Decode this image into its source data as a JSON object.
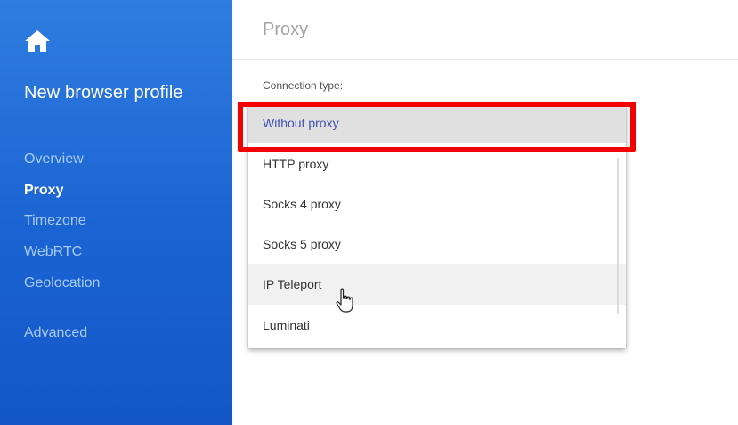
{
  "sidebar": {
    "home_icon": "home-icon",
    "title": "New browser profile",
    "items": [
      {
        "label": "Overview",
        "active": false
      },
      {
        "label": "Proxy",
        "active": true
      },
      {
        "label": "Timezone",
        "active": false
      },
      {
        "label": "WebRTC",
        "active": false
      },
      {
        "label": "Geolocation",
        "active": false
      },
      {
        "label": "Advanced",
        "active": false
      }
    ]
  },
  "main": {
    "title": "Proxy",
    "connection_label": "Connection type:",
    "dropdown": {
      "options": [
        {
          "label": "Without proxy",
          "state": "selected"
        },
        {
          "label": "HTTP proxy",
          "state": "normal"
        },
        {
          "label": "Socks 4 proxy",
          "state": "normal"
        },
        {
          "label": "Socks 5 proxy",
          "state": "normal"
        },
        {
          "label": "IP Teleport",
          "state": "hovered"
        },
        {
          "label": "Luminati",
          "state": "normal"
        }
      ]
    }
  },
  "overlay": {
    "highlight_color": "#f50000",
    "cursor_icon": "hand-pointer-icon"
  },
  "colors": {
    "sidebar_blue": "#1a63d2",
    "selected_text": "#3f51b5",
    "inactive_nav": "#a9ccf6"
  }
}
